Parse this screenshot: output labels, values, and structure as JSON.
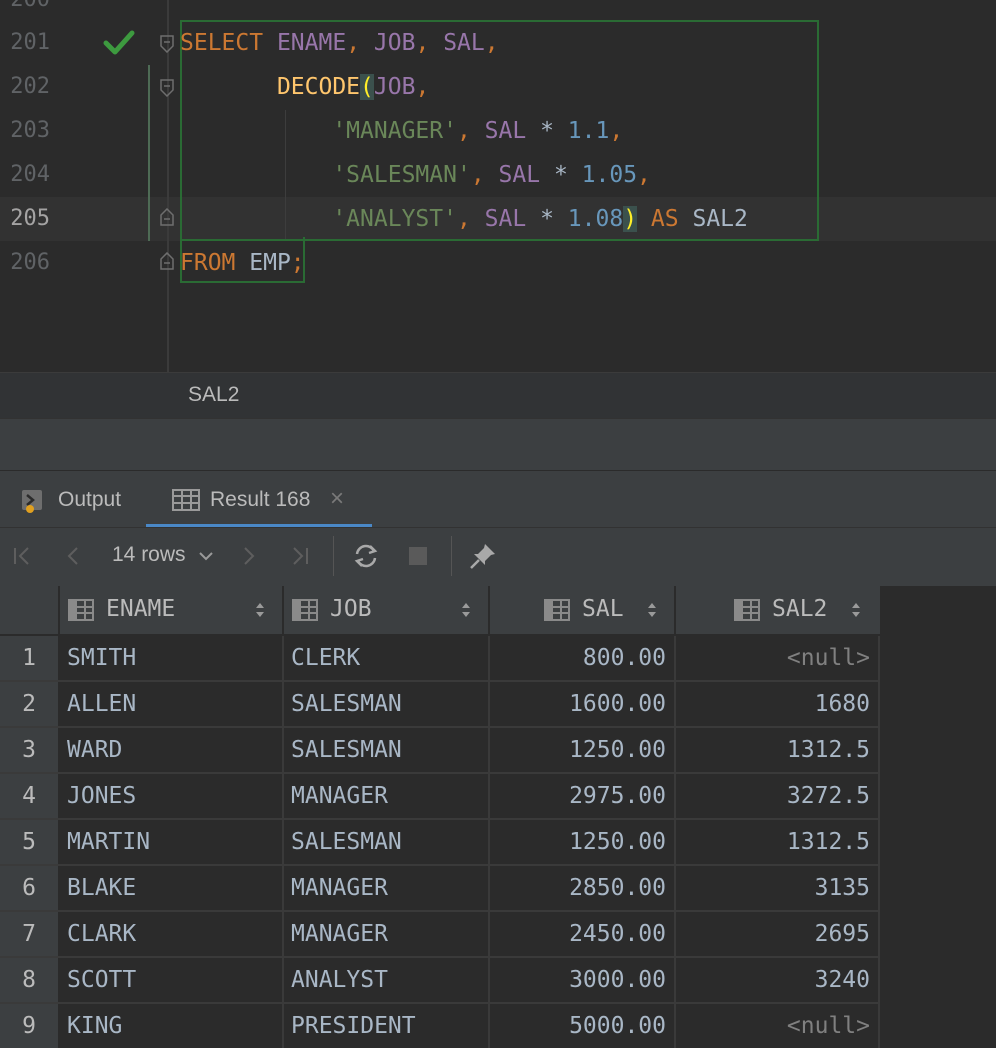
{
  "editor": {
    "partial_top_line": "200",
    "lines": [
      {
        "num": "201"
      },
      {
        "num": "202"
      },
      {
        "num": "203"
      },
      {
        "num": "204"
      },
      {
        "num": "205"
      },
      {
        "num": "206"
      }
    ],
    "code": {
      "l1": {
        "select": "SELECT",
        "ename": "ENAME",
        "c1": ",",
        "job": "JOB",
        "c2": ",",
        "sal": "SAL",
        "c3": ","
      },
      "l2": {
        "decode": "DECODE",
        "paren": "(",
        "job": "JOB",
        "c": ","
      },
      "l3": {
        "str": "'MANAGER'",
        "c1": ",",
        "sal": "SAL",
        "op": "*",
        "num": "1.1",
        "c2": ","
      },
      "l4": {
        "str": "'SALESMAN'",
        "c1": ",",
        "sal": "SAL",
        "op": "*",
        "num": "1.05",
        "c2": ","
      },
      "l5": {
        "str": "'ANALYST'",
        "c1": ",",
        "sal": "SAL",
        "op": "*",
        "num": "1.08",
        "paren": ")",
        "as": "AS",
        "alias": "SAL2"
      },
      "l6": {
        "from": "FROM",
        "emp": "EMP",
        "semi": ";"
      }
    }
  },
  "breadcrumb": {
    "item": "SAL2"
  },
  "tabs": [
    {
      "label": "Output",
      "icon": "output-icon"
    },
    {
      "label": "Result 168",
      "icon": "table-icon",
      "close": "×"
    }
  ],
  "toolbar": {
    "rows_label": "14 rows",
    "buttons": [
      "first-page-icon",
      "prev-page-icon",
      "next-page-icon",
      "last-page-icon",
      "refresh-icon",
      "stop-icon",
      "pin-icon"
    ]
  },
  "grid": {
    "columns": [
      "ENAME",
      "JOB",
      "SAL",
      "SAL2"
    ],
    "rows": [
      {
        "n": "1",
        "ename": "SMITH",
        "job": "CLERK",
        "sal": "800.00",
        "sal2": "<null>"
      },
      {
        "n": "2",
        "ename": "ALLEN",
        "job": "SALESMAN",
        "sal": "1600.00",
        "sal2": "1680"
      },
      {
        "n": "3",
        "ename": "WARD",
        "job": "SALESMAN",
        "sal": "1250.00",
        "sal2": "1312.5"
      },
      {
        "n": "4",
        "ename": "JONES",
        "job": "MANAGER",
        "sal": "2975.00",
        "sal2": "3272.5"
      },
      {
        "n": "5",
        "ename": "MARTIN",
        "job": "SALESMAN",
        "sal": "1250.00",
        "sal2": "1312.5"
      },
      {
        "n": "6",
        "ename": "BLAKE",
        "job": "MANAGER",
        "sal": "2850.00",
        "sal2": "3135"
      },
      {
        "n": "7",
        "ename": "CLARK",
        "job": "MANAGER",
        "sal": "2450.00",
        "sal2": "2695"
      },
      {
        "n": "8",
        "ename": "SCOTT",
        "job": "ANALYST",
        "sal": "3000.00",
        "sal2": "3240"
      },
      {
        "n": "9",
        "ename": "KING",
        "job": "PRESIDENT",
        "sal": "5000.00",
        "sal2": "<null>"
      }
    ]
  },
  "colors": {
    "keyword": "#cc7832",
    "column": "#9876aa",
    "function": "#ffc66d",
    "string": "#6a8759",
    "number": "#6897bb",
    "success_check": "#3d9a3f"
  }
}
